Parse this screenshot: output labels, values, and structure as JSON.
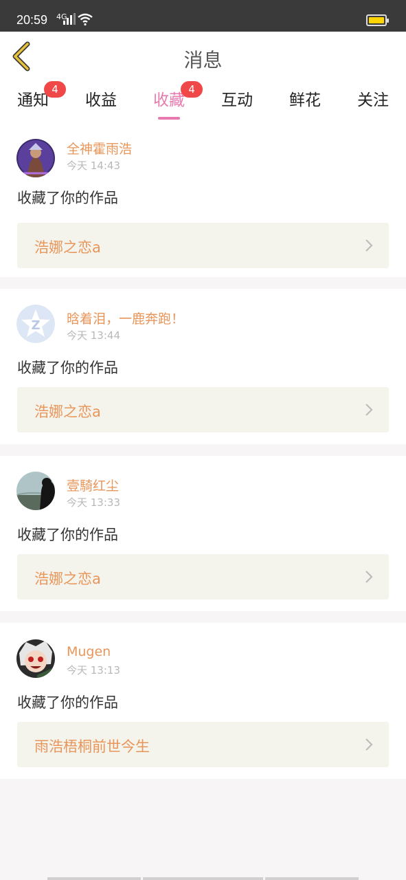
{
  "status": {
    "time": "20:59",
    "network": "4G"
  },
  "header": {
    "title": "消息"
  },
  "tabs": [
    {
      "label": "通知",
      "badge": "4",
      "active": false
    },
    {
      "label": "收益",
      "badge": "",
      "active": false
    },
    {
      "label": "收藏",
      "badge": "4",
      "active": true
    },
    {
      "label": "互动",
      "badge": "",
      "active": false
    },
    {
      "label": "鲜花",
      "badge": "",
      "active": false
    },
    {
      "label": "关注",
      "badge": "",
      "active": false
    }
  ],
  "messages": [
    {
      "name": "全神霍雨浩",
      "time": "今天 14:43",
      "action": "收藏了你的作品",
      "work": "浩娜之恋a"
    },
    {
      "name": "晗着泪，一鹿奔跑！",
      "time": "今天 13:44",
      "action": "收藏了你的作品",
      "work": "浩娜之恋a"
    },
    {
      "name": "壹騎红尘",
      "time": "今天 13:33",
      "action": "收藏了你的作品",
      "work": "浩娜之恋a"
    },
    {
      "name": "Mugen",
      "time": "今天 13:13",
      "action": "收藏了你的作品",
      "work": "雨浩梧桐前世今生"
    }
  ],
  "colors": {
    "accent": "#e87ab0",
    "name": "#e8955a",
    "badge": "#f04848",
    "workBg": "#f5f4ec"
  }
}
